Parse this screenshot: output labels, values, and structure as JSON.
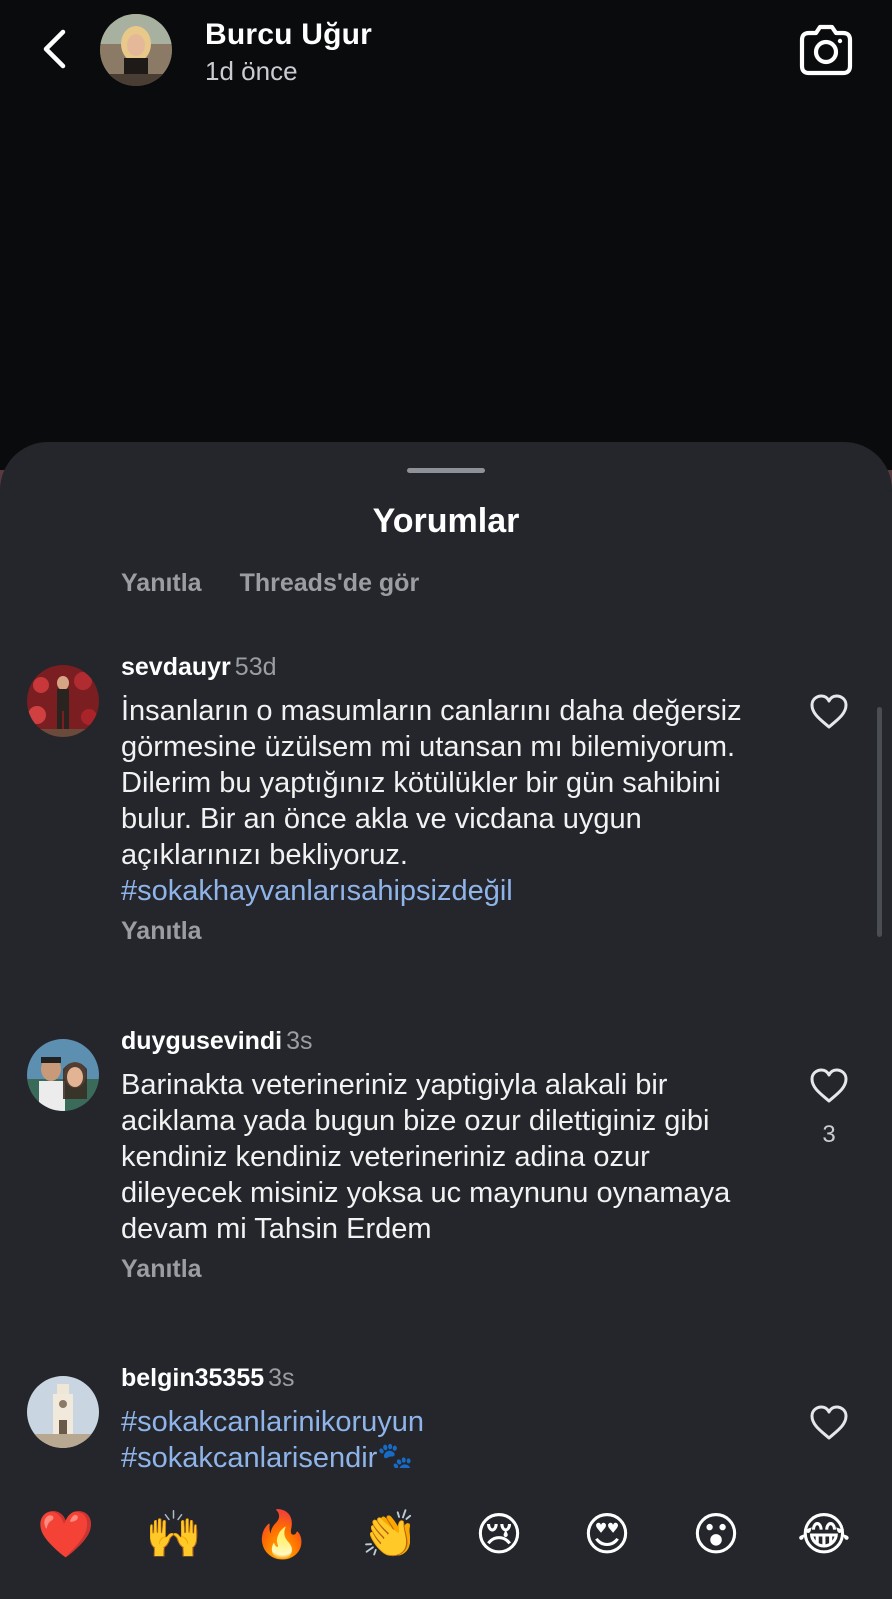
{
  "story": {
    "username": "Burcu Uğur",
    "time": "1d önce"
  },
  "sheet": {
    "title": "Yorumlar",
    "actions": [
      "Yanıtla",
      "Threads'de gör"
    ]
  },
  "comments": [
    {
      "username": "sevdauyr",
      "time": "53d",
      "text": "İnsanların o masumların canlarını daha değersiz görmesine üzülsem mi utansan mı bilemiyorum. Dilerim bu yaptığınız kötülükler bir gün sahibini bulur. Bir an önce akla ve vicdana uygun açıklarınızı bekliyoruz.",
      "hashtag": "#sokakhayvanlarısahipsizdeğil",
      "reply": "Yanıtla"
    },
    {
      "username": "duygusevindi",
      "time": "3s",
      "text": "Barinakta veterineriniz yaptigiyla alakali bir aciklama yada bugun bize ozur dilettiginiz gibi kendiniz kendiniz veterineriniz adina ozur dileyecek misiniz yoksa uc maynunu oynamaya devam mi Tahsin Erdem",
      "likes": "3",
      "reply": "Yanıtla"
    },
    {
      "username": "belgin35355",
      "time": "3s",
      "hashtag": "#sokakcanlarinikoruyun",
      "hashtag2": "#sokakcanlarisendir🐾"
    }
  ],
  "reactions": [
    {
      "name": "heart",
      "glyph": "❤️"
    },
    {
      "name": "raised-hands",
      "glyph": "🙌"
    },
    {
      "name": "fire",
      "glyph": "🔥"
    },
    {
      "name": "clapping-hands",
      "glyph": "👏"
    },
    {
      "name": "crying-face",
      "glyph": "😢"
    },
    {
      "name": "heart-eyes",
      "glyph": "😍"
    },
    {
      "name": "surprised-face",
      "glyph": "😮"
    },
    {
      "name": "tears-of-joy",
      "glyph": "😂"
    }
  ]
}
